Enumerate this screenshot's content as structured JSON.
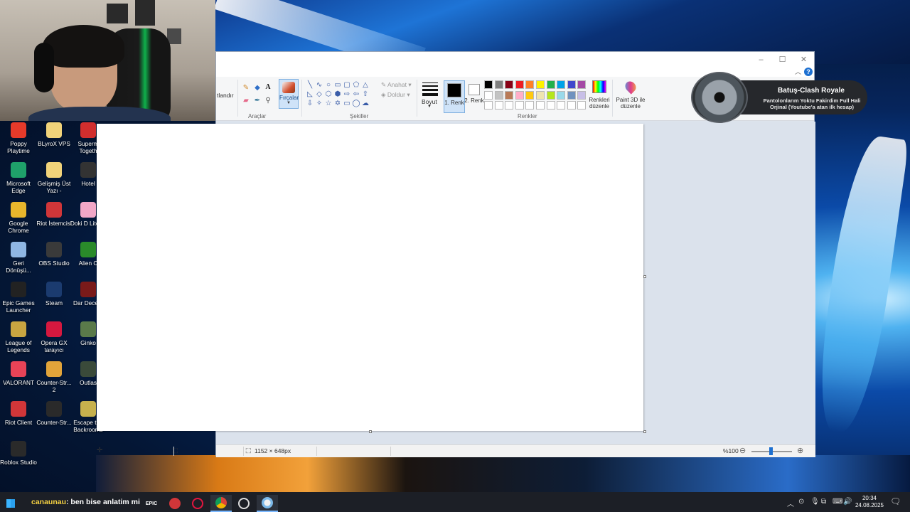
{
  "webcam": {},
  "desktop_icons": [
    {
      "label": "Poppy Playtime",
      "icon": "poppy-playtime-icon",
      "color": "#e63a2a"
    },
    {
      "label": "BLyroX VPS",
      "icon": "folder-icon",
      "color": "#f1d37a"
    },
    {
      "label": "Superm Togeth",
      "icon": "supermarket-together-icon",
      "color": "#d12e2e"
    },
    {
      "label": "Microsoft Edge",
      "icon": "edge-icon",
      "color": "#1fa16a"
    },
    {
      "label": "Gelişmiş Üst Yazı -",
      "icon": "document-icon",
      "color": "#f1d37a"
    },
    {
      "label": "Hotel",
      "icon": "hotel-icon",
      "color": "#333333"
    },
    {
      "label": "Google Chrome",
      "icon": "chrome-icon",
      "color": "#e8b62c"
    },
    {
      "label": "Riot İstemcisi",
      "icon": "riot-client-icon",
      "color": "#d13639"
    },
    {
      "label": "Doki D Literat",
      "icon": "doki-doki-icon",
      "color": "#f2a7c7"
    },
    {
      "label": "Geri Dönüşü...",
      "icon": "recycle-bin-icon",
      "color": "#8fb6e3"
    },
    {
      "label": "OBS Studio",
      "icon": "obs-icon",
      "color": "#3a3a3a"
    },
    {
      "label": "Alien C",
      "icon": "alien-icon",
      "color": "#2a8a2a"
    },
    {
      "label": "Epic Games Launcher",
      "icon": "epic-games-icon",
      "color": "#222222"
    },
    {
      "label": "Steam",
      "icon": "steam-icon",
      "color": "#1b3b6f"
    },
    {
      "label": "Dar Decept",
      "icon": "dark-deception-icon",
      "color": "#7a1a1a"
    },
    {
      "label": "League of Legends",
      "icon": "league-icon",
      "color": "#c9a541"
    },
    {
      "label": "Opera GX tarayıcı",
      "icon": "opera-gx-icon",
      "color": "#d6183f"
    },
    {
      "label": "Ginko",
      "icon": "ginko-icon",
      "color": "#5a7a4a"
    },
    {
      "label": "VALORANT",
      "icon": "valorant-icon",
      "color": "#e84357"
    },
    {
      "label": "Counter-Str... 2",
      "icon": "cs2-icon",
      "color": "#e2a43a"
    },
    {
      "label": "Outlas",
      "icon": "outlast-icon",
      "color": "#3a4a3a"
    },
    {
      "label": "Riot Client",
      "icon": "riot-client-icon",
      "color": "#d13639"
    },
    {
      "label": "Counter-Str...",
      "icon": "cs-icon",
      "color": "#2a2a2a"
    },
    {
      "label": "Escape the Backrooms",
      "icon": "backrooms-icon",
      "color": "#c7b14d"
    },
    {
      "label": "Roblox Studio",
      "icon": "roblox-icon",
      "color": "#2a2a2a"
    }
  ],
  "paint": {
    "tabs_partial": "tlandır",
    "groups": {
      "tools": "Araçlar",
      "shapes": "Şekiller",
      "colors": "Renkler"
    },
    "brushes_label": "Fırçalar",
    "outline_label": "Anahat",
    "fill_label": "Doldur",
    "size_label": "Boyut",
    "color1_label": "1. Renk",
    "color2_label": "2. Renk",
    "edit_colors_label": "Renkleri düzenle",
    "paint3d_label": "Paint 3D ile düzenle",
    "color1": "#000000",
    "color2": "#ffffff",
    "palette_row1": [
      "#000000",
      "#7f7f7f",
      "#880015",
      "#ed1c24",
      "#ff7f27",
      "#fff200",
      "#22b14c",
      "#00a2e8",
      "#3f48cc",
      "#a349a4"
    ],
    "palette_row2": [
      "#ffffff",
      "#c3c3c3",
      "#b97a57",
      "#ffaec9",
      "#ffc90e",
      "#efe4b0",
      "#b5e61d",
      "#99d9ea",
      "#7092be",
      "#c8bfe7"
    ],
    "palette_row3": [
      "#ffffff",
      "#ffffff",
      "#ffffff",
      "#ffffff",
      "#ffffff",
      "#ffffff",
      "#ffffff",
      "#ffffff",
      "#ffffff",
      "#ffffff"
    ],
    "status": {
      "canvas_size": "1152 × 648px",
      "zoom": "%100"
    }
  },
  "overlay": {
    "title": "Batuş-Clash Royale",
    "subtitle": "Pantolonlarım Yoktu Fakirdim Full Hali Orjinal (Youtube'a atan ilk hesap)"
  },
  "taskbar": {
    "chat_user": "canaunau",
    "chat_message": ": ben bise anlatim mi",
    "date": "24.08.2025",
    "time": "20:34"
  }
}
